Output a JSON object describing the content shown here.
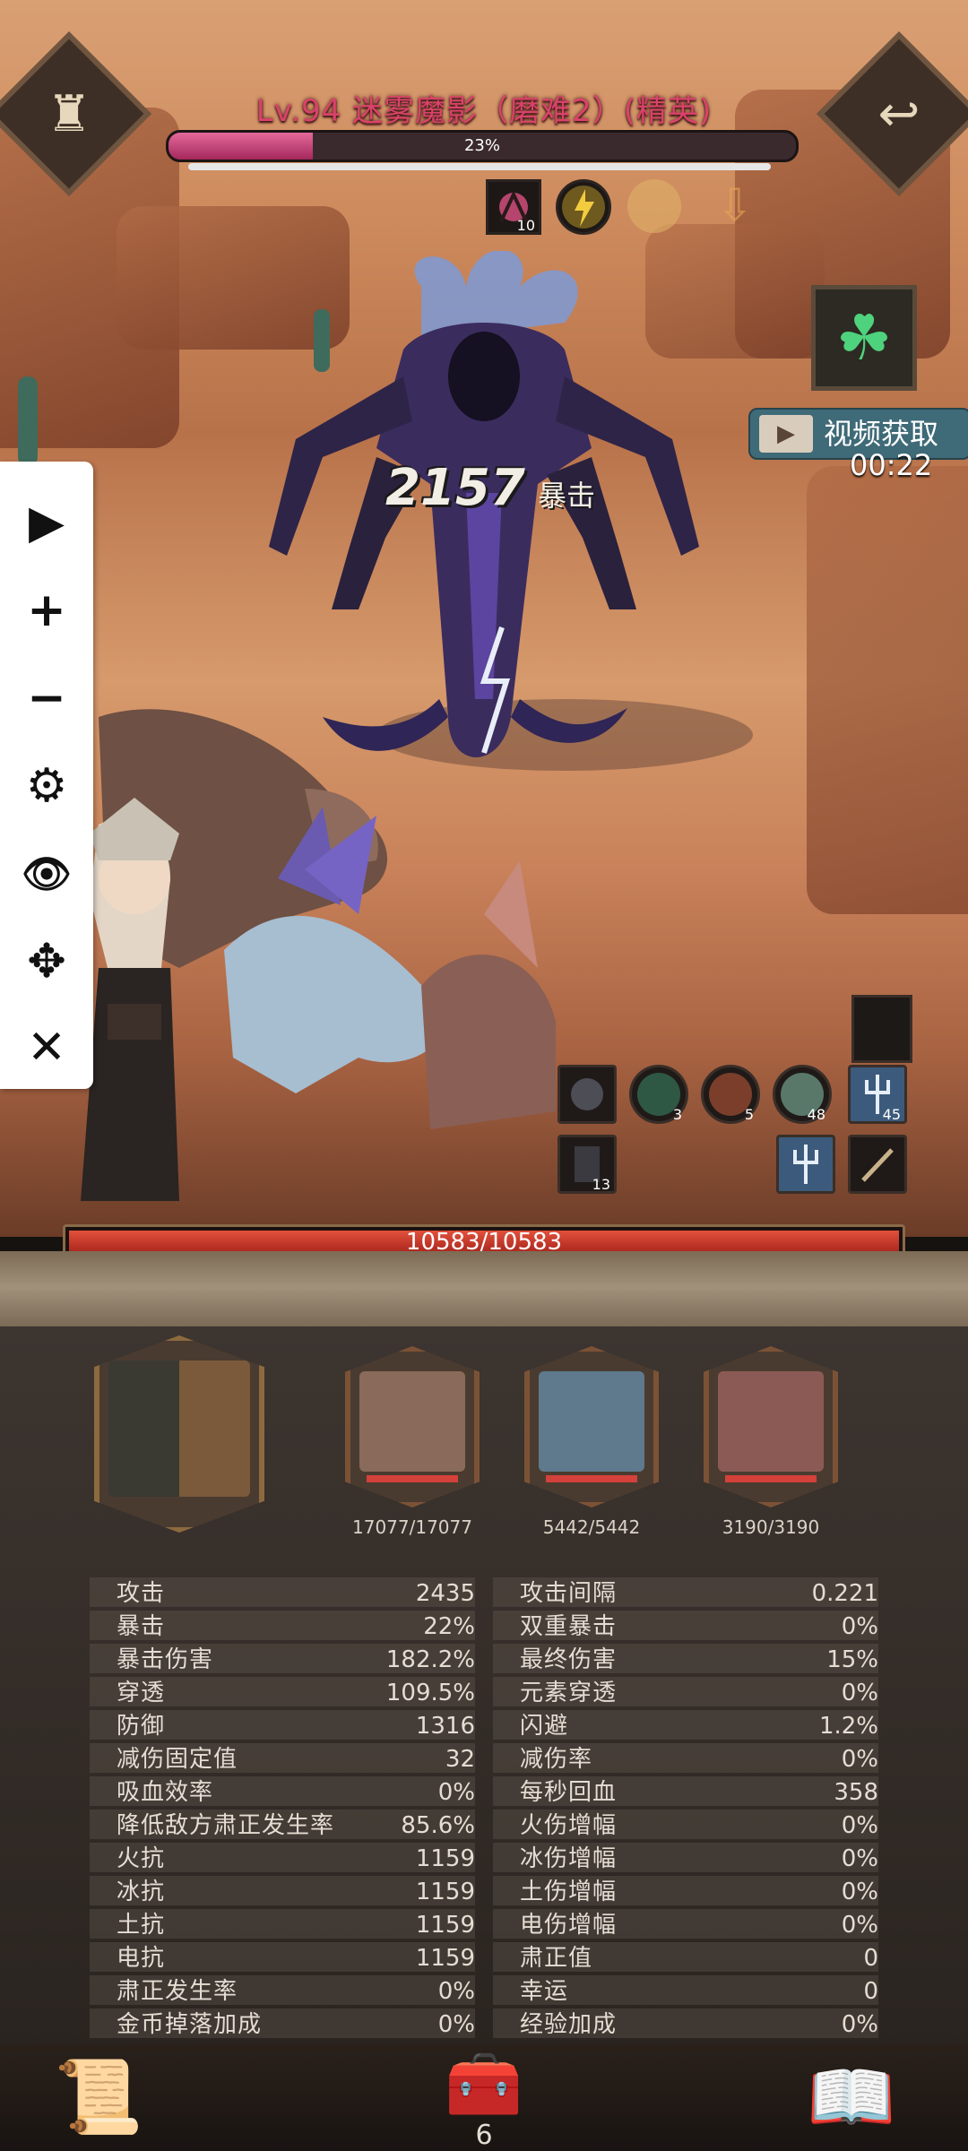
{
  "boss": {
    "title": "Lv.94 迷雾魔影（磨难2）(精英)",
    "hp_percent_label": "23%",
    "hp_fraction": 0.23,
    "buffs": [
      {
        "icon": "claw-buff-icon",
        "count": "10"
      },
      {
        "icon": "lightning-buff-icon",
        "count": ""
      }
    ]
  },
  "battle": {
    "damage_number": "2157",
    "damage_tag": "暴击"
  },
  "reward": {
    "video_label": "视频获取",
    "timer": "00:22"
  },
  "toolbar": {
    "play": "▶",
    "zoom_in": "+",
    "zoom_out": "−",
    "settings": "⚙",
    "view": "👁",
    "move": "✥",
    "close": "✕"
  },
  "skills": [
    {
      "icon": "dark-skill-icon",
      "count": ""
    },
    {
      "icon": "beast-skill-icon",
      "count": "3"
    },
    {
      "icon": "fire-skill-icon",
      "count": "5"
    },
    {
      "icon": "wolf-skill-icon",
      "count": "48"
    },
    {
      "icon": "trident-skill-icon",
      "count": "45"
    },
    {
      "icon": "shadow-skill-icon",
      "count": "13"
    },
    {
      "icon": "trident-skill-icon-2",
      "count": ""
    },
    {
      "icon": "staff-skill-icon",
      "count": ""
    }
  ],
  "player": {
    "hp_text": "10583/10583"
  },
  "team": [
    {
      "name": "hero",
      "hp": ""
    },
    {
      "name": "bear",
      "hp": "17077/17077"
    },
    {
      "name": "wolf",
      "hp": "5442/5442"
    },
    {
      "name": "boar",
      "hp": "3190/3190"
    }
  ],
  "stats": [
    {
      "lk": "攻击",
      "lv": "2435",
      "rk": "攻击间隔",
      "rv": "0.221"
    },
    {
      "lk": "暴击",
      "lv": "22%",
      "rk": "双重暴击",
      "rv": "0%"
    },
    {
      "lk": "暴击伤害",
      "lv": "182.2%",
      "rk": "最终伤害",
      "rv": "15%"
    },
    {
      "lk": "穿透",
      "lv": "109.5%",
      "rk": "元素穿透",
      "rv": "0%"
    },
    {
      "lk": "防御",
      "lv": "1316",
      "rk": "闪避",
      "rv": "1.2%"
    },
    {
      "lk": "减伤固定值",
      "lv": "32",
      "rk": "减伤率",
      "rv": "0%"
    },
    {
      "lk": "吸血效率",
      "lv": "0%",
      "rk": "每秒回血",
      "rv": "358"
    },
    {
      "lk": "降低敌方肃正发生率",
      "lv": "85.6%",
      "rk": "火伤增幅",
      "rv": "0%"
    },
    {
      "lk": "火抗",
      "lv": "1159",
      "rk": "冰伤增幅",
      "rv": "0%"
    },
    {
      "lk": "冰抗",
      "lv": "1159",
      "rk": "土伤增幅",
      "rv": "0%"
    },
    {
      "lk": "土抗",
      "lv": "1159",
      "rk": "电伤增幅",
      "rv": "0%"
    },
    {
      "lk": "电抗",
      "lv": "1159",
      "rk": "肃正值",
      "rv": "0"
    },
    {
      "lk": "肃正发生率",
      "lv": "0%",
      "rk": "幸运",
      "rv": "0"
    },
    {
      "lk": "金币掉落加成",
      "lv": "0%",
      "rk": "经验加成",
      "rv": "0%"
    }
  ],
  "nav": {
    "page": "6",
    "left": "📜",
    "right": "📖",
    "center": "🧰"
  },
  "colors": {
    "boss_hp": "#c23a6e",
    "player_hp": "#d13a2b",
    "accent": "#8c6a3e"
  }
}
